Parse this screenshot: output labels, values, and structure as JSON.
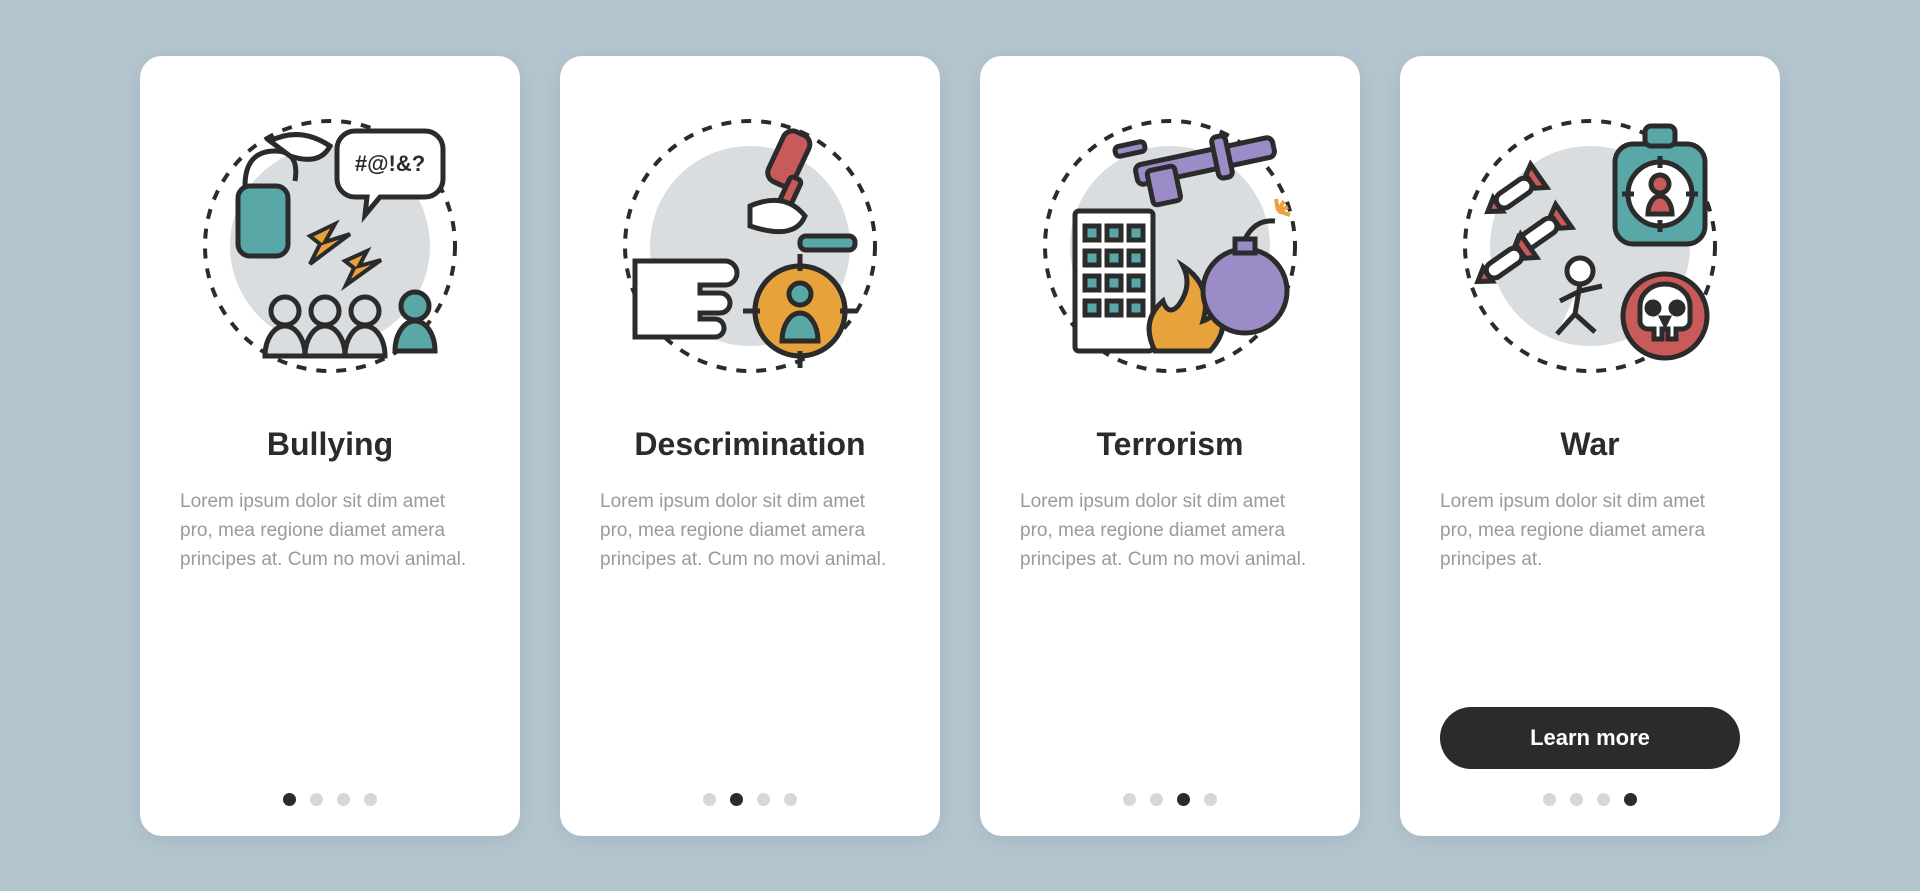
{
  "colors": {
    "bg": "#b3c5cf",
    "card": "#ffffff",
    "title": "#2b2b2b",
    "text": "#9a9a9a",
    "dotActive": "#2b2b2b",
    "dotInactive": "#d7d7d7",
    "button": "#2b2b2b",
    "accentTeal": "#5aa7a7",
    "accentOrange": "#e8a23c",
    "accentRed": "#c85a5a",
    "accentPurple": "#9b8cc7",
    "circleGray": "#d9dde0"
  },
  "dotsPerCard": 4,
  "cards": [
    {
      "id": "bullying",
      "title": "Bullying",
      "desc": "Lorem ipsum dolor sit dim amet pro, mea regione diamet amera principes at. Cum no movi animal.",
      "activeDot": 0,
      "iconName": "bullying-icon",
      "hasButton": false
    },
    {
      "id": "discrimination",
      "title": "Descrimination",
      "desc": "Lorem ipsum dolor sit dim amet pro, mea regione diamet amera principes at. Cum no movi animal.",
      "activeDot": 1,
      "iconName": "discrimination-icon",
      "hasButton": false
    },
    {
      "id": "terrorism",
      "title": "Terrorism",
      "desc": "Lorem ipsum dolor sit dim amet pro, mea regione diamet amera principes at. Cum no movi animal.",
      "activeDot": 2,
      "iconName": "terrorism-icon",
      "hasButton": false
    },
    {
      "id": "war",
      "title": "War",
      "desc": "Lorem ipsum dolor sit dim amet pro, mea regione diamet amera principes at.",
      "activeDot": 3,
      "iconName": "war-icon",
      "hasButton": true,
      "buttonLabel": "Learn more"
    }
  ]
}
